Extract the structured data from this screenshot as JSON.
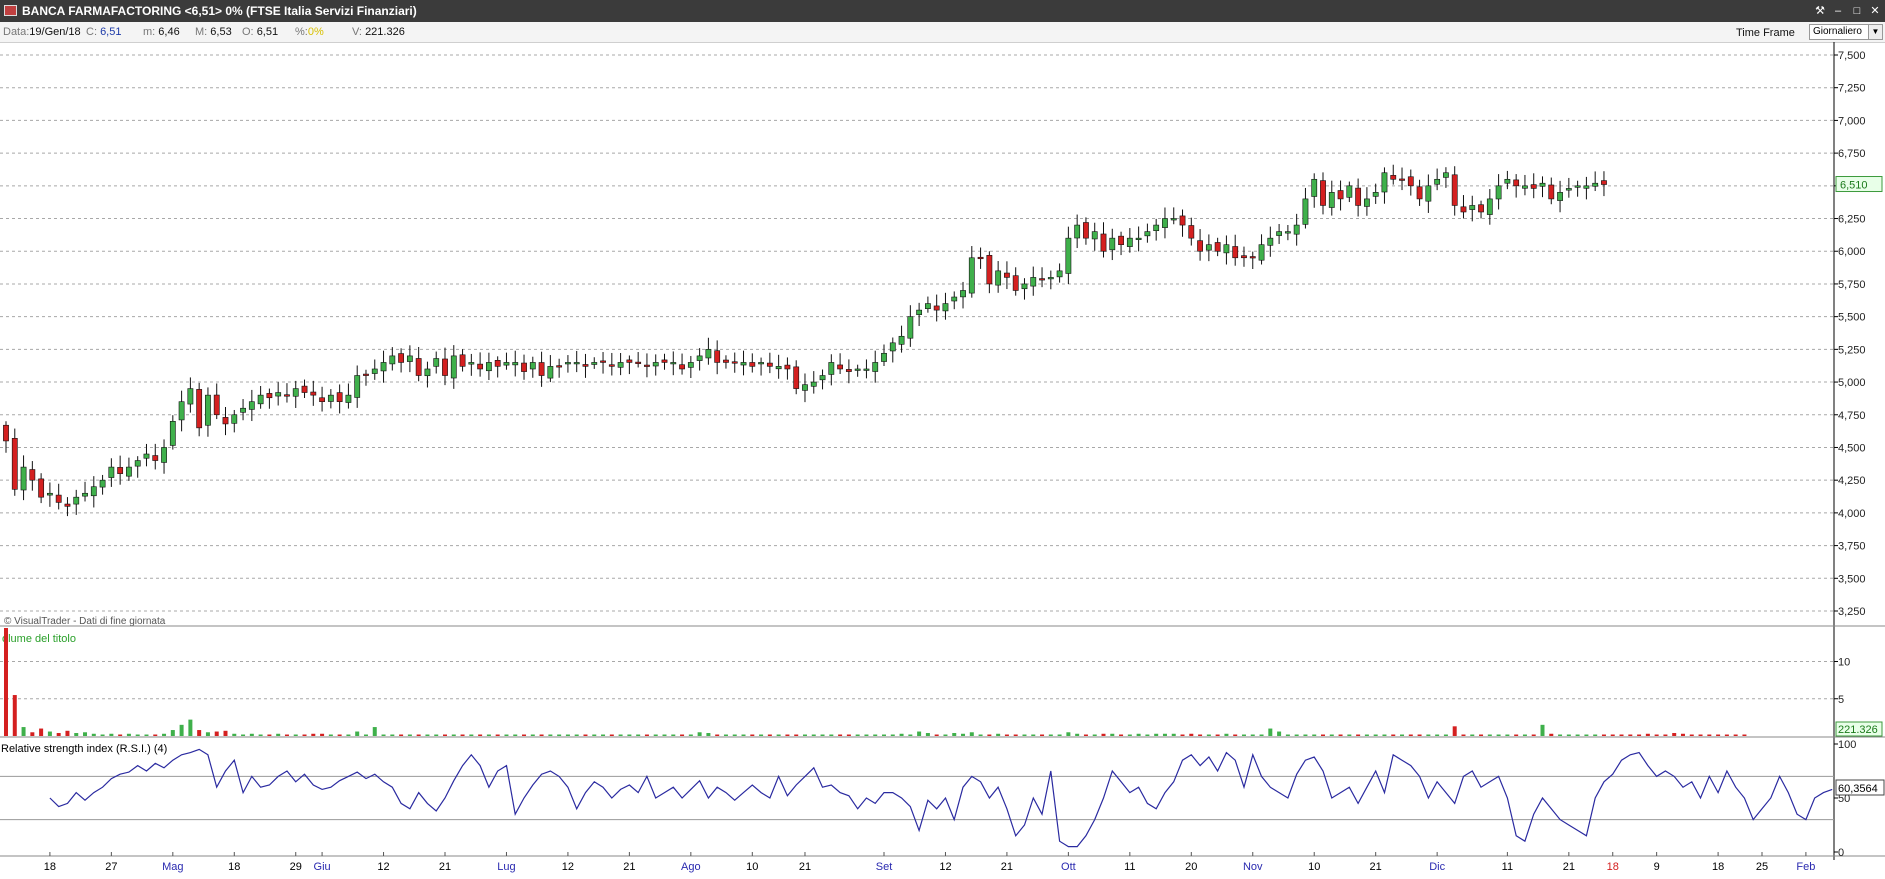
{
  "window": {
    "title": "BANCA FARMAFACTORING <6,51> 0%  (FTSE Italia Servizi Finanziari)"
  },
  "infobar": {
    "data_label": "Data:",
    "data_value": "19/Gen/18",
    "close_label": "C:",
    "close_value": "6,51",
    "min_label": "m:",
    "min_value": "6,46",
    "max_label": "M:",
    "max_value": "6,53",
    "open_label": "O:",
    "open_value": "6,51",
    "pct_label": "%:",
    "pct_value": "0%",
    "vol_label": "V:",
    "vol_value": "221.326",
    "timeframe_label": "Time Frame",
    "timeframe_value": "Giornaliero"
  },
  "colors": {
    "up": "#3fb04b",
    "down": "#d42020",
    "rsi": "#2a2aa0",
    "grid": "#a8a8a8",
    "axis": "#000000",
    "last_value_bg": "#e8ffe8",
    "last_value_border": "#3c9a3c"
  },
  "chart_data": [
    {
      "type": "candlestick",
      "y_ticks": [
        "7,500",
        "7,250",
        "7,000",
        "6,750",
        "6,500",
        "6,250",
        "6,000",
        "5,750",
        "5,500",
        "5,250",
        "5,000",
        "4,750",
        "4,500",
        "4,250",
        "4,000",
        "3,750",
        "3,500",
        "3,250"
      ],
      "ylim": [
        3.25,
        7.5
      ],
      "last_value_label": "6,510",
      "last_value": 6.51,
      "footer": "© VisualTrader - Dati di fine giornata",
      "closes": [
        4.55,
        4.18,
        4.35,
        4.25,
        4.12,
        4.15,
        4.08,
        4.05,
        4.12,
        4.15,
        4.2,
        4.25,
        4.35,
        4.3,
        4.35,
        4.4,
        4.45,
        4.4,
        4.5,
        4.7,
        4.85,
        4.95,
        4.65,
        4.9,
        4.75,
        4.68,
        4.75,
        4.8,
        4.85,
        4.9,
        4.88,
        4.92,
        4.9,
        4.95,
        4.92,
        4.9,
        4.85,
        4.9,
        4.85,
        4.9,
        5.05,
        5.05,
        5.1,
        5.15,
        5.2,
        5.15,
        5.2,
        5.05,
        5.1,
        5.18,
        5.05,
        5.2,
        5.12,
        5.15,
        5.1,
        5.15,
        5.12,
        5.15,
        5.15,
        5.08,
        5.15,
        5.05,
        5.12,
        5.12,
        5.15,
        5.15,
        5.12,
        5.15,
        5.15,
        5.12,
        5.15,
        5.15,
        5.15,
        5.12,
        5.15,
        5.15,
        5.15,
        5.1,
        5.15,
        5.2,
        5.25,
        5.15,
        5.15,
        5.15,
        5.15,
        5.12,
        5.15,
        5.12,
        5.12,
        5.1,
        4.95,
        4.98,
        5.0,
        5.05,
        5.15,
        5.1,
        5.08,
        5.1,
        5.1,
        5.15,
        5.22,
        5.3,
        5.35,
        5.5,
        5.55,
        5.6,
        5.55,
        5.6,
        5.65,
        5.7,
        5.95,
        5.95,
        5.75,
        5.85,
        5.8,
        5.7,
        5.75,
        5.8,
        5.78,
        5.8,
        5.85,
        6.1,
        6.2,
        6.1,
        6.15,
        6.0,
        6.1,
        6.05,
        6.1,
        6.1,
        6.15,
        6.2,
        6.25,
        6.25,
        6.2,
        6.1,
        6.0,
        6.05,
        6.0,
        6.05,
        5.95,
        5.95,
        5.95,
        6.05,
        6.1,
        6.15,
        6.15,
        6.2,
        6.4,
        6.55,
        6.35,
        6.45,
        6.4,
        6.5,
        6.35,
        6.4,
        6.45,
        6.6,
        6.55,
        6.55,
        6.5,
        6.4,
        6.5,
        6.55,
        6.6,
        6.35,
        6.3,
        6.35,
        6.3,
        6.4,
        6.5,
        6.55,
        6.5,
        6.5,
        6.48,
        6.52,
        6.4,
        6.45,
        6.48,
        6.5,
        6.5,
        6.52,
        6.51
      ],
      "x_labels": [
        {
          "text": "18",
          "at": 5,
          "color": "#000"
        },
        {
          "text": "27",
          "at": 12,
          "color": "#000"
        },
        {
          "text": "Mag",
          "at": 19,
          "color": "#2a2ab0"
        },
        {
          "text": "18",
          "at": 26,
          "color": "#000"
        },
        {
          "text": "29",
          "at": 33,
          "color": "#000"
        },
        {
          "text": "Giu",
          "at": 36,
          "color": "#2a2ab0"
        },
        {
          "text": "12",
          "at": 43,
          "color": "#000"
        },
        {
          "text": "21",
          "at": 50,
          "color": "#000"
        },
        {
          "text": "Lug",
          "at": 57,
          "color": "#2a2ab0"
        },
        {
          "text": "12",
          "at": 64,
          "color": "#000"
        },
        {
          "text": "21",
          "at": 71,
          "color": "#000"
        },
        {
          "text": "Ago",
          "at": 78,
          "color": "#2a2ab0"
        },
        {
          "text": "10",
          "at": 85,
          "color": "#000"
        },
        {
          "text": "21",
          "at": 91,
          "color": "#000"
        },
        {
          "text": "Set",
          "at": 100,
          "color": "#2a2ab0"
        },
        {
          "text": "12",
          "at": 107,
          "color": "#000"
        },
        {
          "text": "21",
          "at": 114,
          "color": "#000"
        },
        {
          "text": "Ott",
          "at": 121,
          "color": "#2a2ab0"
        },
        {
          "text": "11",
          "at": 128,
          "color": "#000"
        },
        {
          "text": "20",
          "at": 135,
          "color": "#000"
        },
        {
          "text": "Nov",
          "at": 142,
          "color": "#2a2ab0"
        },
        {
          "text": "10",
          "at": 149,
          "color": "#000"
        },
        {
          "text": "21",
          "at": 156,
          "color": "#000"
        },
        {
          "text": "Dic",
          "at": 163,
          "color": "#2a2ab0"
        },
        {
          "text": "11",
          "at": 171,
          "color": "#000"
        },
        {
          "text": "21",
          "at": 178,
          "color": "#000"
        },
        {
          "text": "18",
          "at": 183,
          "color": "#d42020"
        },
        {
          "text": "9",
          "at": 188,
          "color": "#000"
        },
        {
          "text": "18",
          "at": 195,
          "color": "#000"
        },
        {
          "text": "25",
          "at": 200,
          "color": "#000"
        },
        {
          "text": "Feb",
          "at": 205,
          "color": "#2a2ab0"
        }
      ]
    },
    {
      "type": "bar",
      "title": "olume del titolo",
      "y_ticks": [
        "10",
        "5"
      ],
      "ylim": [
        0,
        14.5
      ],
      "last_value_label": "221.326",
      "values": [
        14.5,
        5.5,
        1.2,
        0.5,
        1.0,
        0.6,
        0.4,
        0.7,
        0.4,
        0.5,
        0.3,
        0.2,
        0.3,
        0.2,
        0.3,
        0.2,
        0.2,
        0.2,
        0.3,
        0.8,
        1.5,
        2.2,
        0.8,
        0.5,
        0.6,
        0.7,
        0.3,
        0.2,
        0.3,
        0.2,
        0.2,
        0.3,
        0.2,
        0.2,
        0.2,
        0.3,
        0.3,
        0.2,
        0.2,
        0.2,
        0.6,
        0.2,
        1.2,
        0.2,
        0.2,
        0.2,
        0.2,
        0.2,
        0.2,
        0.2,
        0.2,
        0.2,
        0.2,
        0.2,
        0.2,
        0.2,
        0.2,
        0.2,
        0.2,
        0.2,
        0.2,
        0.2,
        0.2,
        0.2,
        0.2,
        0.2,
        0.2,
        0.2,
        0.2,
        0.2,
        0.2,
        0.2,
        0.2,
        0.2,
        0.2,
        0.2,
        0.2,
        0.2,
        0.2,
        0.5,
        0.4,
        0.2,
        0.2,
        0.2,
        0.2,
        0.2,
        0.2,
        0.2,
        0.2,
        0.2,
        0.2,
        0.2,
        0.2,
        0.2,
        0.2,
        0.2,
        0.2,
        0.2,
        0.2,
        0.2,
        0.2,
        0.2,
        0.3,
        0.2,
        0.6,
        0.4,
        0.2,
        0.2,
        0.4,
        0.3,
        0.5,
        0.2,
        0.2,
        0.3,
        0.2,
        0.2,
        0.2,
        0.2,
        0.2,
        0.2,
        0.2,
        0.5,
        0.3,
        0.2,
        0.2,
        0.3,
        0.3,
        0.2,
        0.2,
        0.3,
        0.2,
        0.3,
        0.3,
        0.3,
        0.2,
        0.3,
        0.2,
        0.2,
        0.2,
        0.3,
        0.2,
        0.2,
        0.2,
        0.2,
        1.0,
        0.6,
        0.2,
        0.2,
        0.2,
        0.2,
        0.2,
        0.2,
        0.2,
        0.2,
        0.2,
        0.2,
        0.2,
        0.2,
        0.2,
        0.2,
        0.2,
        0.2,
        0.2,
        0.2,
        0.2,
        1.3,
        0.2,
        0.2,
        0.2,
        0.2,
        0.2,
        0.2,
        0.2,
        0.2,
        0.2,
        1.5,
        0.3,
        0.2,
        0.2,
        0.2,
        0.2,
        0.2,
        0.2,
        0.2,
        0.2,
        0.2,
        0.2,
        0.3,
        0.2,
        0.2,
        0.4,
        0.3,
        0.2,
        0.2,
        0.2,
        0.2,
        0.2,
        0.2,
        0.2
      ]
    },
    {
      "type": "line",
      "title": "Relative strength index (R.S.I.) (4)",
      "y_ticks": [
        "100",
        "50",
        "0"
      ],
      "ylim": [
        0,
        100
      ],
      "last_value_label": "60,3564",
      "levels": [
        70,
        30
      ],
      "values": [
        50,
        42,
        45,
        55,
        48,
        55,
        60,
        68,
        72,
        74,
        80,
        75,
        82,
        78,
        85,
        90,
        92,
        95,
        90,
        60,
        75,
        85,
        55,
        70,
        60,
        62,
        70,
        75,
        65,
        72,
        62,
        58,
        60,
        66,
        70,
        74,
        68,
        72,
        65,
        60,
        45,
        40,
        55,
        45,
        38,
        50,
        66,
        80,
        90,
        80,
        60,
        75,
        80,
        35,
        50,
        62,
        72,
        75,
        70,
        60,
        40,
        55,
        65,
        60,
        50,
        58,
        62,
        55,
        70,
        50,
        55,
        60,
        50,
        58,
        66,
        50,
        60,
        55,
        48,
        55,
        62,
        55,
        50,
        70,
        52,
        62,
        70,
        78,
        60,
        62,
        55,
        52,
        40,
        50,
        45,
        55,
        55,
        50,
        42,
        20,
        48,
        40,
        50,
        30,
        60,
        70,
        65,
        50,
        60,
        40,
        15,
        25,
        50,
        35,
        75,
        10,
        5,
        5,
        15,
        30,
        50,
        75,
        65,
        55,
        60,
        45,
        40,
        55,
        65,
        85,
        90,
        80,
        88,
        75,
        92,
        85,
        60,
        90,
        70,
        60,
        55,
        50,
        72,
        85,
        88,
        75,
        50,
        55,
        60,
        45,
        60,
        75,
        55,
        90,
        85,
        80,
        70,
        50,
        65,
        55,
        45,
        70,
        75,
        60,
        65,
        70,
        50,
        15,
        10,
        35,
        50,
        40,
        30,
        25,
        20,
        15,
        50,
        65,
        72,
        85,
        90,
        92,
        80,
        70,
        75,
        70,
        60,
        65,
        50,
        70,
        55,
        75,
        60,
        50,
        30,
        40,
        50,
        70,
        55,
        35,
        30,
        50,
        55,
        58
      ]
    }
  ]
}
